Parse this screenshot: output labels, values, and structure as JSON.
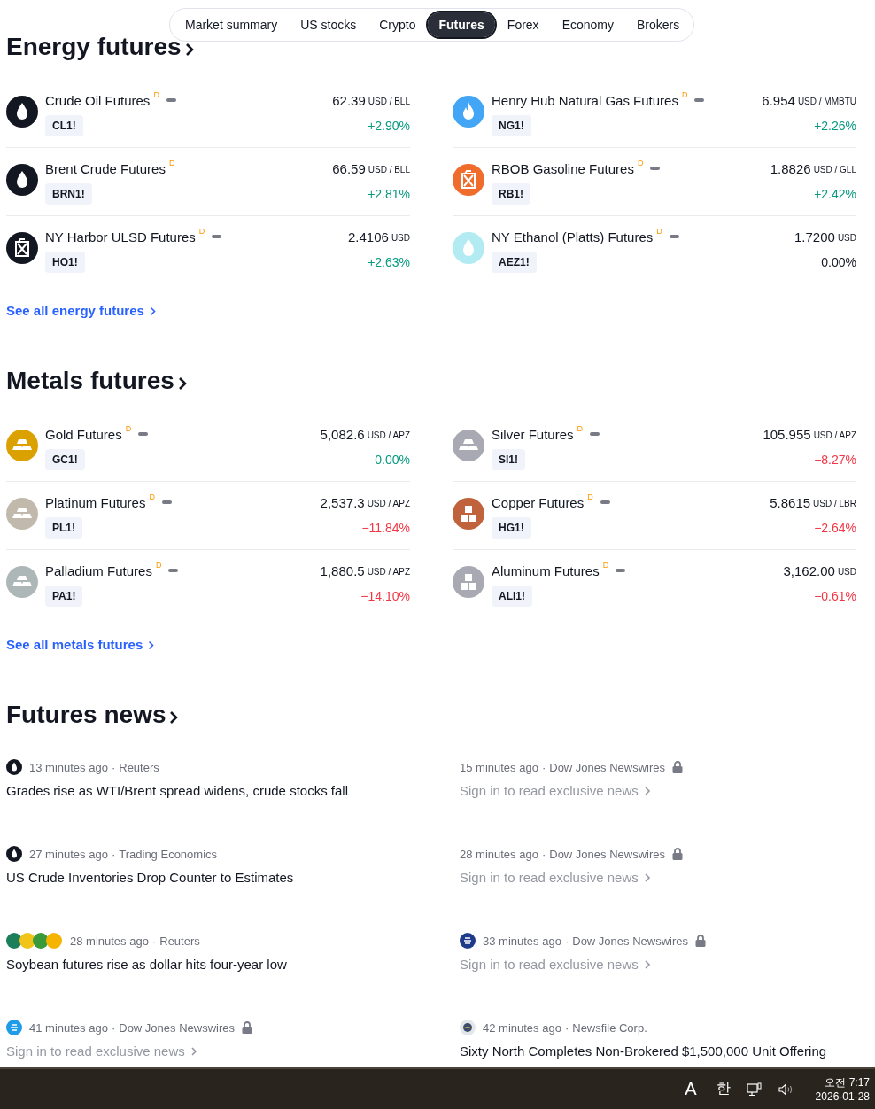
{
  "tabs": [
    {
      "label": "Market summary",
      "selected": false
    },
    {
      "label": "US stocks",
      "selected": false
    },
    {
      "label": "Crypto",
      "selected": false
    },
    {
      "label": "Futures",
      "selected": true
    },
    {
      "label": "Forex",
      "selected": false
    },
    {
      "label": "Economy",
      "selected": false
    },
    {
      "label": "Brokers",
      "selected": false
    }
  ],
  "sections": [
    {
      "title": "Energy futures",
      "link": "See all energy futures",
      "items": [
        {
          "name": "Crude Oil Futures",
          "delayed": "D",
          "closed": true,
          "symbol": "CL1!",
          "price": "62.39",
          "unit": "USD / BLL",
          "change": {
            "text": "+2.90%",
            "color": "#089981"
          },
          "logo": {
            "kind": "drop",
            "color": "#131722"
          }
        },
        {
          "name": "Henry Hub Natural Gas Futures",
          "delayed": "D",
          "closed": true,
          "symbol": "NG1!",
          "price": "6.954",
          "unit": "USD / MMBTU",
          "change": {
            "text": "+2.26%",
            "color": "#089981"
          },
          "logo": {
            "kind": "flame",
            "color": "#42a5f5"
          }
        },
        {
          "name": "Brent Crude Futures",
          "delayed": "D",
          "closed": false,
          "symbol": "BRN1!",
          "price": "66.59",
          "unit": "USD / BLL",
          "change": {
            "text": "+2.81%",
            "color": "#089981"
          },
          "logo": {
            "kind": "drop",
            "color": "#131722"
          }
        },
        {
          "name": "RBOB Gasoline Futures",
          "delayed": "D",
          "closed": true,
          "symbol": "RB1!",
          "price": "1.8826",
          "unit": "USD / GLL",
          "change": {
            "text": "+2.42%",
            "color": "#089981"
          },
          "logo": {
            "kind": "canister",
            "color": "#ef6c2c"
          }
        },
        {
          "name": "NY Harbor ULSD Futures",
          "delayed": "D",
          "closed": true,
          "symbol": "HO1!",
          "price": "2.4106",
          "unit": "USD",
          "change": {
            "text": "+2.63%",
            "color": "#089981"
          },
          "logo": {
            "kind": "canister",
            "color": "#131722"
          }
        },
        {
          "name": "NY Ethanol (Platts) Futures",
          "delayed": "D",
          "closed": true,
          "symbol": "AEZ1!",
          "price": "1.7200",
          "unit": "USD",
          "change": {
            "text": "0.00%",
            "color": "#131722"
          },
          "logo": {
            "kind": "drop",
            "color": "#b2ebf2"
          }
        }
      ]
    },
    {
      "title": "Metals futures",
      "link": "See all metals futures",
      "items": [
        {
          "name": "Gold Futures",
          "delayed": "D",
          "closed": true,
          "symbol": "GC1!",
          "price": "5,082.6",
          "unit": "USD / APZ",
          "change": {
            "text": "0.00%",
            "color": "#089981"
          },
          "logo": {
            "kind": "bars",
            "color": "#dba100"
          }
        },
        {
          "name": "Silver Futures",
          "delayed": "D",
          "closed": true,
          "symbol": "SI1!",
          "price": "105.955",
          "unit": "USD / APZ",
          "change": {
            "text": "−8.27%",
            "color": "#f23645"
          },
          "logo": {
            "kind": "bars",
            "color": "#a9a9b3"
          }
        },
        {
          "name": "Platinum Futures",
          "delayed": "D",
          "closed": true,
          "symbol": "PL1!",
          "price": "2,537.3",
          "unit": "USD / APZ",
          "change": {
            "text": "−11.84%",
            "color": "#f23645"
          },
          "logo": {
            "kind": "bars",
            "color": "#c2b9ad"
          }
        },
        {
          "name": "Copper Futures",
          "delayed": "D",
          "closed": true,
          "symbol": "HG1!",
          "price": "5.8615",
          "unit": "USD / LBR",
          "change": {
            "text": "−2.64%",
            "color": "#f23645"
          },
          "logo": {
            "kind": "blocks",
            "color": "#c0623b"
          }
        },
        {
          "name": "Palladium Futures",
          "delayed": "D",
          "closed": true,
          "symbol": "PA1!",
          "price": "1,880.5",
          "unit": "USD / APZ",
          "change": {
            "text": "−14.10%",
            "color": "#f23645"
          },
          "logo": {
            "kind": "bars",
            "color": "#adb7b8"
          }
        },
        {
          "name": "Aluminum Futures",
          "delayed": "D",
          "closed": true,
          "symbol": "ALI1!",
          "price": "3,162.00",
          "unit": "USD",
          "change": {
            "text": "−0.61%",
            "color": "#f23645"
          },
          "logo": {
            "kind": "blocks",
            "color": "#a9a9b3"
          }
        }
      ]
    }
  ],
  "news": {
    "title": "Futures news",
    "items": [
      {
        "kind": "drop",
        "time": "13 minutes ago",
        "separator": "·",
        "source": "Reuters",
        "locked": false,
        "headline": "Grades rise as WTI/Brent spread widens, crude stocks fall"
      },
      {
        "kind": "plain",
        "time": "15 minutes ago",
        "separator": "·",
        "source": "Dow Jones Newswires",
        "locked": true,
        "headline": "Sign in to read exclusive news"
      },
      {
        "kind": "drop",
        "time": "27 minutes ago",
        "separator": "·",
        "source": "Trading Economics",
        "locked": false,
        "headline": "US Crude Inventories Drop Counter to Estimates"
      },
      {
        "kind": "plain",
        "time": "28 minutes ago",
        "separator": "·",
        "source": "Dow Jones Newswires",
        "locked": true,
        "headline": "Sign in to read exclusive news"
      },
      {
        "kind": "multi",
        "time": "28 minutes ago",
        "separator": "·",
        "source": "Reuters",
        "locked": false,
        "headline": "Soybean futures rise as dollar hits four-year low"
      },
      {
        "kind": "navy",
        "time": "33 minutes ago",
        "separator": "·",
        "source": "Dow Jones Newswires",
        "locked": true,
        "headline": "Sign in to read exclusive news"
      },
      {
        "kind": "blue",
        "time": "41 minutes ago",
        "separator": "·",
        "source": "Dow Jones Newswires",
        "locked": true,
        "headline": "Sign in to read exclusive news"
      },
      {
        "kind": "globe",
        "time": "42 minutes ago",
        "separator": "·",
        "source": "Newsfile Corp.",
        "locked": false,
        "headline": "Sixty North Completes Non-Brokered $1,500,000 Unit Offering"
      }
    ]
  },
  "taskbar": {
    "input_mode": "A",
    "ime": "한",
    "time": "오전 7:17",
    "date": "2026-01-28"
  }
}
